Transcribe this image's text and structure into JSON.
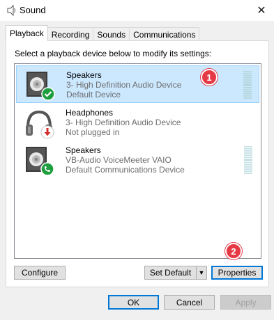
{
  "window": {
    "title": "Sound",
    "close_glyph": "✕"
  },
  "tabs": [
    {
      "label": "Playback",
      "active": true
    },
    {
      "label": "Recording",
      "active": false
    },
    {
      "label": "Sounds",
      "active": false
    },
    {
      "label": "Communications",
      "active": false
    }
  ],
  "instruction": "Select a playback device below to modify its settings:",
  "devices": [
    {
      "name": "Speakers",
      "line2": "3- High Definition Audio Device",
      "line3": "Default Device",
      "icon": "speaker-icon",
      "status_icon": "check-circle-icon",
      "selected": true
    },
    {
      "name": "Headphones",
      "line2": "3- High Definition Audio Device",
      "line3": "Not plugged in",
      "icon": "headphones-icon",
      "status_icon": "unplugged-arrow-icon",
      "selected": false
    },
    {
      "name": "Speakers",
      "line2": "VB-Audio VoiceMeeter VAIO",
      "line3": "Default Communications Device",
      "icon": "speaker-icon",
      "status_icon": "phone-circle-icon",
      "selected": false
    }
  ],
  "annotations": {
    "badge1": "1",
    "badge2": "2",
    "badge_color": "#e63946"
  },
  "buttons": {
    "configure": "Configure",
    "set_default": "Set Default",
    "set_default_arrow": "▼",
    "properties": "Properties",
    "ok": "OK",
    "cancel": "Cancel",
    "apply": "Apply"
  },
  "colors": {
    "selection": "#cce8ff",
    "accent": "#0078d7"
  }
}
